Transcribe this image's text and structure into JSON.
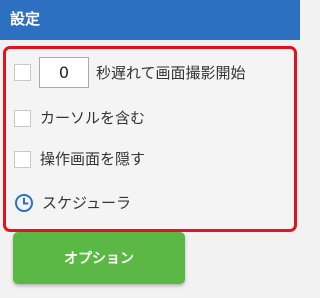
{
  "header": {
    "title": "設定"
  },
  "settings": {
    "delay": {
      "checked": false,
      "value": "0",
      "label": "秒遅れて画面撮影開始"
    },
    "include_cursor": {
      "checked": false,
      "label": "カーソルを含む"
    },
    "hide_window": {
      "checked": false,
      "label": "操作画面を隠す"
    },
    "scheduler": {
      "icon": "clock-icon",
      "label": "スケジューラ"
    }
  },
  "options_button": {
    "label": "オプション"
  },
  "colors": {
    "header_bg": "#2d6fc0",
    "highlight_border": "#e0141e",
    "button_bg": "#5cb845",
    "icon_blue": "#2d6fc0"
  }
}
